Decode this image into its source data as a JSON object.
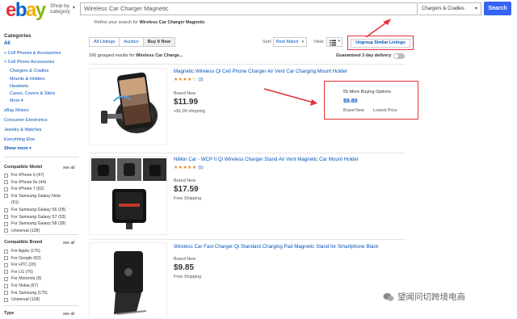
{
  "header": {
    "logo_letters": [
      {
        "ch": "e",
        "color": "#e53238"
      },
      {
        "ch": "b",
        "color": "#0064d2"
      },
      {
        "ch": "a",
        "color": "#f5af02"
      },
      {
        "ch": "y",
        "color": "#86b817"
      }
    ],
    "shop_by_line1": "Shop by",
    "shop_by_line2": "category",
    "search_value": "Wireless Car Charger Magnetic",
    "category_value": "Chargers & Cradles",
    "search_button": "Search",
    "refine_prefix": "Refine your search for",
    "refine_query": "Wireless Car Charger Magnetic"
  },
  "sidebar": {
    "categories_title": "Categories",
    "all": "All",
    "cat_items": [
      "< Cell Phones & Accessories",
      "< Cell Phone Accessories"
    ],
    "sub_items": [
      "Chargers & Cradles",
      "Mounts & Holders",
      "Headsets",
      "Cases, Covers & Skins",
      "More ▾"
    ],
    "other_items": [
      "eBay Motors",
      "Consumer Electronics",
      "Jewelry & Watches",
      "Everything Else"
    ],
    "show_more": "Show more ▾",
    "compatible_model": {
      "title": "Compatible Model",
      "see_all": "see all",
      "items": [
        "For iPhone 6 (47)",
        "For iPhone 6s (44)",
        "For iPhone 7 (62)",
        "For Samsung Galaxy Note",
        "(61)",
        "For Samsung Galaxy S6 (28)",
        "For Samsung Galaxy S7 (33)",
        "For Samsung Galaxy S8 (38)",
        "Universal (128)"
      ]
    },
    "compatible_brand": {
      "title": "Compatible Brand",
      "see_all": "see all",
      "items": [
        "For Apple (175)",
        "For Google (62)",
        "For HTC (20)",
        "For LG (76)",
        "For Motorola (9)",
        "For Nokia (67)",
        "For Samsung (175)",
        "Universal (128)"
      ]
    },
    "type_title": "Type",
    "type_see_all": "see all"
  },
  "toolbar": {
    "tabs": [
      "All Listings",
      "Auction",
      "Buy It Now"
    ],
    "sort_label": "Sort:",
    "sort_value": "Best Match",
    "view_label": "View:",
    "ungroup_label": "Ungroup Similar Listings",
    "results_count": "160 grouped results for",
    "results_query": "Wireless Car Charge...",
    "guarantee": "Guaranteed 3 day delivery"
  },
  "items": [
    {
      "title": "Magnetic Wireless Qi Cell Phone Charger Air Vent Car Charging Mount Holder",
      "stars": "★★★★☆",
      "review_count": "(3)",
      "condition": "Brand New",
      "price": "$11.99",
      "shipping": "+$1.99 shipping",
      "buying_options": "55 More Buying Options",
      "buying_price": "$9.80",
      "buying_condition": "Brand New",
      "buying_low": "Lowest Price"
    },
    {
      "title": "Nillkin Car - WCP II Qi Wireless Charger Stand Air Vent Magnetic Car Mount Holder",
      "stars": "★★★★★",
      "review_count": "(5)",
      "condition": "Brand New",
      "price": "$17.59",
      "shipping": "Free Shipping"
    },
    {
      "title": "Wireless Car Fast Charger Qi Standard Charging Pad Magnetic Stand for Smartphone Black",
      "condition": "Brand New",
      "price": "$9.85",
      "shipping": "Free Shipping"
    }
  ],
  "watermark": "望闻问切跨境电商",
  "colors": {
    "accent": "#3665f3",
    "link": "#0654ba",
    "annotation": "#e0343a",
    "stars": "#e28b1c"
  }
}
